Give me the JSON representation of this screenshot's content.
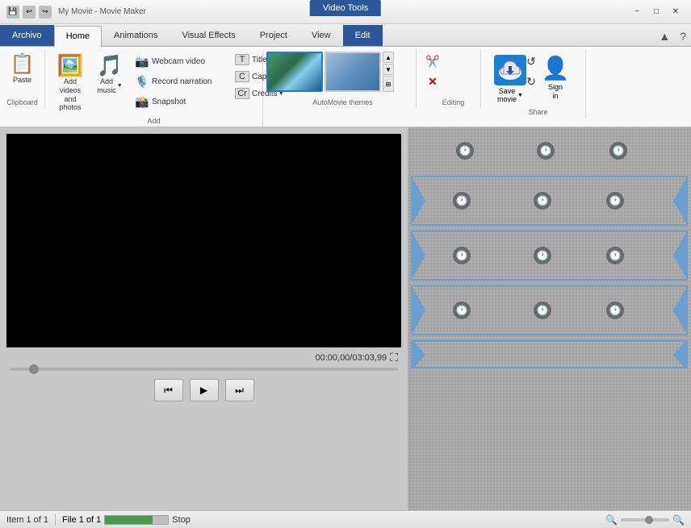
{
  "titlebar": {
    "title": "My Movie - Movie Maker",
    "video_tools_tab": "Video Tools",
    "min_btn": "−",
    "max_btn": "□",
    "close_btn": "✕"
  },
  "ribbon": {
    "tabs": [
      {
        "label": "Archivo",
        "id": "archivo"
      },
      {
        "label": "Home",
        "id": "home"
      },
      {
        "label": "Animations",
        "id": "animations"
      },
      {
        "label": "Visual Effects",
        "id": "visualeffects"
      },
      {
        "label": "Project",
        "id": "project"
      },
      {
        "label": "View",
        "id": "view"
      },
      {
        "label": "Edit",
        "id": "edit"
      }
    ],
    "groups": {
      "clipboard": {
        "label": "Clipboard",
        "paste_label": "Paste"
      },
      "add": {
        "label": "Add",
        "add_videos_label": "Add videos\nand photos",
        "add_music_label": "Add\nmusic",
        "webcam_label": "Webcam video",
        "record_label": "Record narration",
        "snapshot_label": "Snapshot",
        "title_label": "Title",
        "caption_label": "Caption",
        "credits_label": "Credits"
      },
      "automovie": {
        "label": "AutoMovie themes"
      },
      "editing": {
        "label": "Editing",
        "label_text": "Editing"
      },
      "share": {
        "label": "Share",
        "save_movie_label": "Save\nmovie",
        "sign_in_label": "Sign\nin"
      }
    }
  },
  "preview": {
    "time_display": "00:00,00/03:03,99"
  },
  "controls": {
    "rewind_label": "⏮",
    "play_label": "▶",
    "forward_label": "⏭"
  },
  "statusbar": {
    "item_label": "Item 1 of 1",
    "file_label": "File 1 of 1",
    "stop_label": "Stop"
  }
}
